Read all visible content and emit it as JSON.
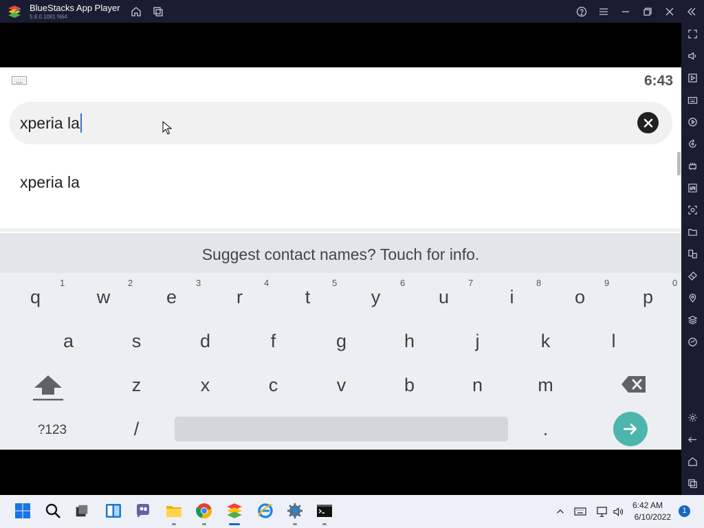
{
  "window": {
    "title": "BlueStacks App Player",
    "version": "5.8.0.1081 N64"
  },
  "android": {
    "clock": "6:43",
    "search": {
      "query": "xperia la"
    },
    "suggestions": [
      "xperia la"
    ],
    "keyboard": {
      "hint": "Suggest contact names? Touch for info.",
      "row1": [
        "q",
        "w",
        "e",
        "r",
        "t",
        "y",
        "u",
        "i",
        "o",
        "p"
      ],
      "row1_hints": [
        "1",
        "2",
        "3",
        "4",
        "5",
        "6",
        "7",
        "8",
        "9",
        "0"
      ],
      "row2": [
        "a",
        "s",
        "d",
        "f",
        "g",
        "h",
        "j",
        "k",
        "l"
      ],
      "row3": [
        "z",
        "x",
        "c",
        "v",
        "b",
        "n",
        "m"
      ],
      "symbols_label": "?123",
      "slash_label": "/",
      "period_label": "."
    }
  },
  "taskbar": {
    "time": "6:42 AM",
    "date": "6/10/2022",
    "notification_count": "1"
  },
  "colors": {
    "chrome": "#1a1d31",
    "accent_teal": "#4db6ac",
    "caret": "#3b6fd6",
    "taskbar": "#eef0f8"
  }
}
